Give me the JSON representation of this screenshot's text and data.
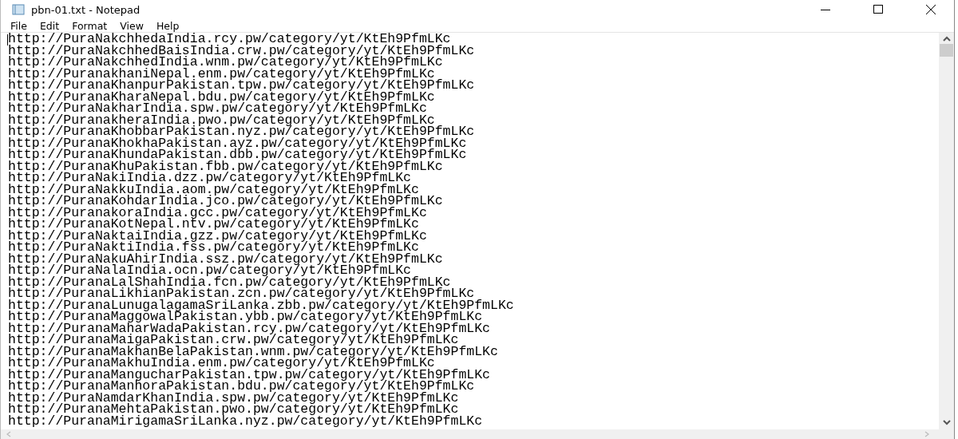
{
  "window": {
    "title": "pbn-01.txt - Notepad"
  },
  "menu": [
    "File",
    "Edit",
    "Format",
    "View",
    "Help"
  ],
  "lines": [
    "http://PuraNakchhedaIndia.rcy.pw/category/yt/KtEh9PfmLKc",
    "http://PuraNakchhedBaisIndia.crw.pw/category/yt/KtEh9PfmLKc",
    "http://PuraNakchhedIndia.wnm.pw/category/yt/KtEh9PfmLKc",
    "http://PuranakhaniNepal.enm.pw/category/yt/KtEh9PfmLKc",
    "http://PuranaKhanpurPakistan.tpw.pw/category/yt/KtEh9PfmLKc",
    "http://PuranaKharaNepal.bdu.pw/category/yt/KtEh9PfmLKc",
    "http://PuraNakharIndia.spw.pw/category/yt/KtEh9PfmLKc",
    "http://PuranakheraIndia.pwo.pw/category/yt/KtEh9PfmLKc",
    "http://PuranaKhobbarPakistan.nyz.pw/category/yt/KtEh9PfmLKc",
    "http://PuranaKhokhaPakistan.ayz.pw/category/yt/KtEh9PfmLKc",
    "http://PuranaKhundaPakistan.dbb.pw/category/yt/KtEh9PfmLKc",
    "http://PuranaKhuPakistan.fbb.pw/category/yt/KtEh9PfmLKc",
    "http://PuraNakiIndia.dzz.pw/category/yt/KtEh9PfmLKc",
    "http://PuraNakkuIndia.aom.pw/category/yt/KtEh9PfmLKc",
    "http://PuranaKohdarIndia.jco.pw/category/yt/KtEh9PfmLKc",
    "http://PuranakoraIndia.gcc.pw/category/yt/KtEh9PfmLKc",
    "http://PuranaKotNepal.ntv.pw/category/yt/KtEh9PfmLKc",
    "http://PuraNaktaiIndia.gzz.pw/category/yt/KtEh9PfmLKc",
    "http://PuraNaktiIndia.fss.pw/category/yt/KtEh9PfmLKc",
    "http://PuraNakuAhirIndia.ssz.pw/category/yt/KtEh9PfmLKc",
    "http://PuraNalaIndia.ocn.pw/category/yt/KtEh9PfmLKc",
    "http://PuranaLalShahIndia.fcn.pw/category/yt/KtEh9PfmLKc",
    "http://PuranaLikhianPakistan.zcn.pw/category/yt/KtEh9PfmLKc",
    "http://PuranaLunugalagamaSriLanka.zbb.pw/category/yt/KtEh9PfmLKc",
    "http://PuranaMaggowalPakistan.ybb.pw/category/yt/KtEh9PfmLKc",
    "http://PuranaMaharWadaPakistan.rcy.pw/category/yt/KtEh9PfmLKc",
    "http://PuranaMaigaPakistan.crw.pw/category/yt/KtEh9PfmLKc",
    "http://PuranaMakhanBelaPakistan.wnm.pw/category/yt/KtEh9PfmLKc",
    "http://PuranaMakhuIndia.enm.pw/category/yt/KtEh9PfmLKc",
    "http://PuranaMangucharPakistan.tpw.pw/category/yt/KtEh9PfmLKc",
    "http://PuranaManhoraPakistan.bdu.pw/category/yt/KtEh9PfmLKc",
    "http://PuraNamdarKhanIndia.spw.pw/category/yt/KtEh9PfmLKc",
    "http://PuranaMehtaPakistan.pwo.pw/category/yt/KtEh9PfmLKc",
    "http://PuranaMirigamaSriLanka.nyz.pw/category/yt/KtEh9PfmLKc"
  ]
}
